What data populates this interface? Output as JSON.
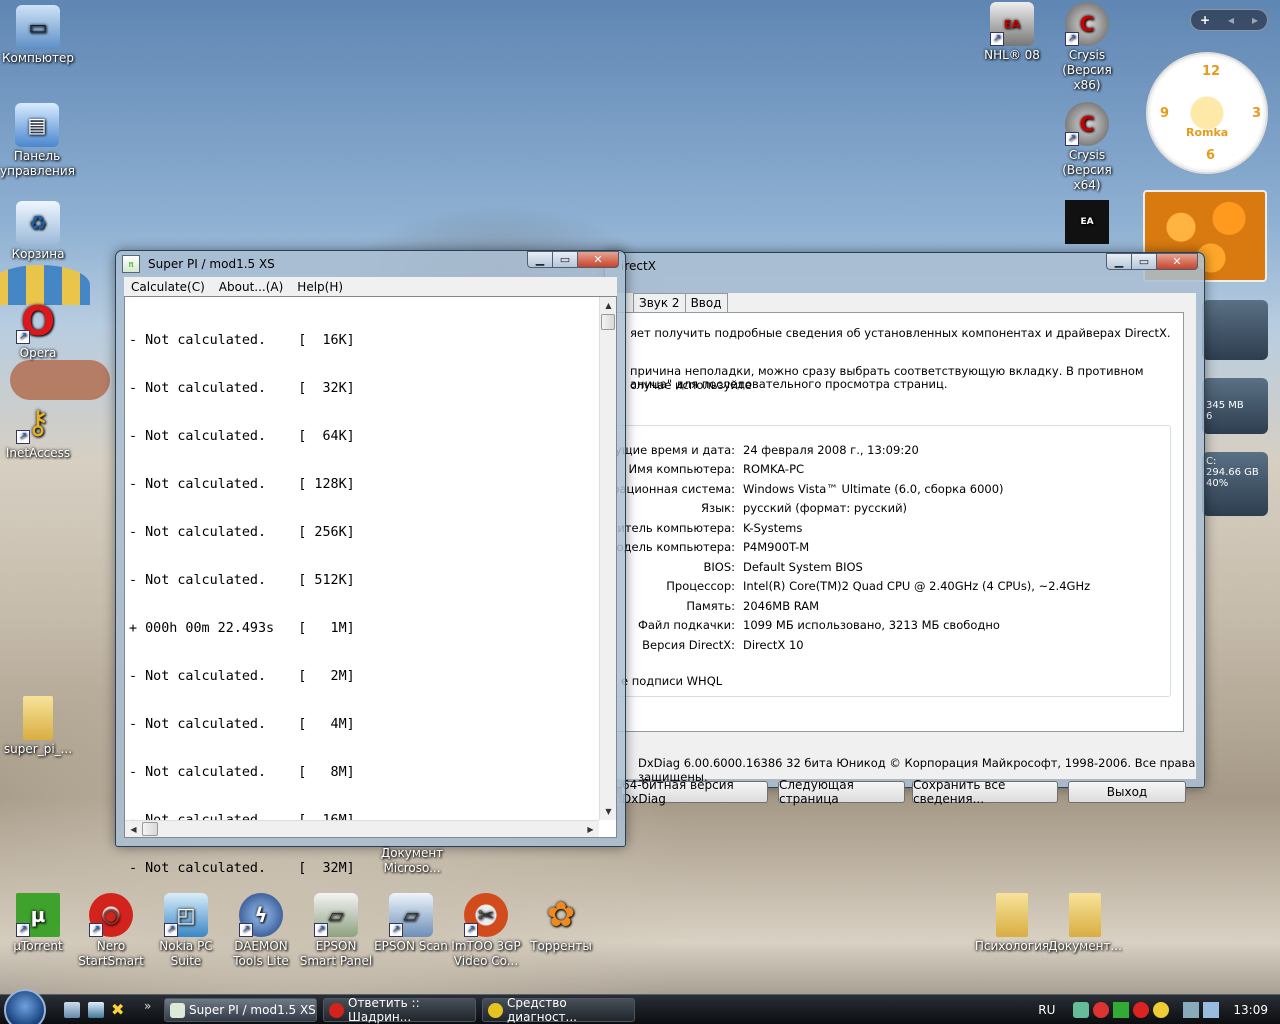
{
  "desktop": {
    "icons_left": [
      {
        "label": "Компьютер"
      },
      {
        "label": "Панель управления"
      },
      {
        "label": "Корзина"
      },
      {
        "label": "Opera"
      },
      {
        "label": "InetAccess"
      },
      {
        "label": "super_pi_..."
      }
    ],
    "icons_right": [
      {
        "label": "NHL® 08"
      },
      {
        "label": "Crysis (Версия x86)"
      },
      {
        "label": "Crysis (Версия x64)"
      }
    ],
    "icons_bottom": [
      {
        "label": "µTorrent"
      },
      {
        "label": "Nero StartSmart"
      },
      {
        "label": "Nokia PC Suite"
      },
      {
        "label": "DAEMON Tools Lite"
      },
      {
        "label": "EPSON Smart Panel"
      },
      {
        "label": "EPSON Scan"
      },
      {
        "label": "ImTOO 3GP Video Co..."
      },
      {
        "label": "Торренты"
      },
      {
        "label": "Психология"
      },
      {
        "label": "Документ..."
      }
    ],
    "partial_doc_label": "Документ Microso..."
  },
  "superpi": {
    "title": "Super PI / mod1.5 XS",
    "menu": [
      "Calculate(C)",
      "About...(A)",
      "Help(H)"
    ],
    "lines": [
      "- Not calculated.    [  16K]",
      "- Not calculated.    [  32K]",
      "- Not calculated.    [  64K]",
      "- Not calculated.    [ 128K]",
      "- Not calculated.    [ 256K]",
      "- Not calculated.    [ 512K]",
      "+ 000h 00m 22.493s   [   1M]",
      "- Not calculated.    [   2M]",
      "- Not calculated.    [   4M]",
      "- Not calculated.    [   8M]",
      "- Not calculated.    [  16M]",
      "- Not calculated.    [  32M]"
    ]
  },
  "dxdiag": {
    "title": "irectX",
    "tabs": [
      "Звук 2",
      "Ввод"
    ],
    "intro1": "яет получить подробные сведения об установленных компонентах и драйверах DirectX.",
    "intro2a": "причина неполадки, можно сразу выбрать соответствующую вкладку. В противном случае используйте",
    "intro2b": "аница\" для последовательного просмотра страниц.",
    "sysinfo": [
      {
        "k": "Текущие время и дата:",
        "v": "24 февраля 2008 г., 13:09:20"
      },
      {
        "k": "Имя компьютера:",
        "v": "ROMKA-PC"
      },
      {
        "k": "Операционная система:",
        "v": "Windows Vista™ Ultimate (6.0, сборка 6000)"
      },
      {
        "k": "Язык:",
        "v": "русский (формат: русский)"
      },
      {
        "k": "отовитель компьютера:",
        "v": "K-Systems"
      },
      {
        "k": "Модель компьютера:",
        "v": "P4M900T-M"
      },
      {
        "k": "BIOS:",
        "v": "Default System BIOS"
      },
      {
        "k": "Процессор:",
        "v": "Intel(R) Core(TM)2 Quad CPU         @ 2.40GHz (4 CPUs), ~2.4GHz"
      },
      {
        "k": "Память:",
        "v": "2046MB RAM"
      },
      {
        "k": "Файл подкачки:",
        "v": "1099 МБ использовано, 3213 МБ свободно"
      },
      {
        "k": "Версия DirectX:",
        "v": "DirectX 10"
      }
    ],
    "whql": "е подписи WHQL",
    "footer": "DxDiag 6.00.6000.16386 32 бита Юникод  © Корпорация Майкрософт, 1998-2006.  Все права защищены.",
    "buttons": [
      "64-битная версия DxDiag",
      "Следующая страница",
      "Сохранить все сведения...",
      "Выход"
    ]
  },
  "gadgets": {
    "clock_label": "Romka",
    "clock_nums": [
      "12",
      "3",
      "6",
      "9"
    ],
    "mem_text": "345 MB",
    "mem_pct": "6",
    "disk_label": "C:",
    "disk_text": "294.66 GB",
    "disk_pct": "40%"
  },
  "taskbar": {
    "items": [
      "Super PI / mod1.5 XS",
      "Ответить :: Шадрин...",
      "Средство диагност..."
    ],
    "lang": "RU",
    "time": "13:09"
  }
}
